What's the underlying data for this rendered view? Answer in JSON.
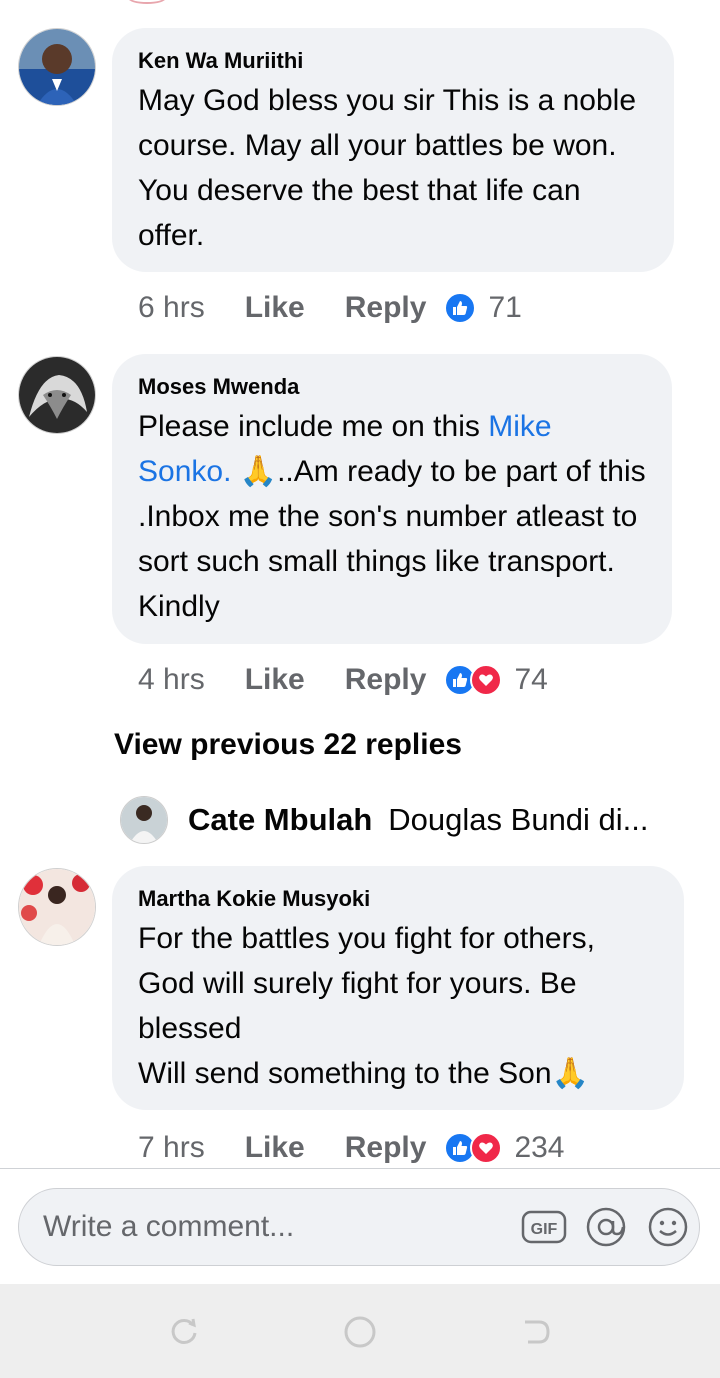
{
  "comments": [
    {
      "author": "Ken Wa Muriithi",
      "text": "May God bless you sir This is a noble course. May all your battles be won. You deserve the best that life can offer.",
      "time": "6 hrs",
      "like_label": "Like",
      "reply_label": "Reply",
      "reaction_count": "71"
    },
    {
      "author": "Moses Mwenda",
      "text_before": "Please include me on this ",
      "mention": "Mike Sonko.",
      "text_after": " 🙏..Am ready to be part of this .Inbox me the son's number atleast to sort such small things like transport. Kindly",
      "time": "4 hrs",
      "like_label": "Like",
      "reply_label": "Reply",
      "reaction_count": "74"
    },
    {
      "author": "Martha Kokie Musyoki",
      "text": "For the battles you fight for others, God will surely fight for yours. Be blessed",
      "text_line2": "Will send something to the Son🙏",
      "time": "7 hrs",
      "like_label": "Like",
      "reply_label": "Reply",
      "reaction_count": "234"
    }
  ],
  "view_previous": "View previous 22 replies",
  "reply_preview": {
    "name": "Cate Mbulah",
    "snippet": "Douglas Bundi di..."
  },
  "composer": {
    "placeholder": "Write a comment..."
  },
  "icons": {
    "gif": "gif-icon",
    "mention": "at-icon",
    "emoji": "emoji-icon",
    "like": "thumbs-up-icon",
    "love": "heart-icon"
  },
  "colors": {
    "link": "#1b74e4",
    "like": "#1877f2",
    "love": "#f02849",
    "bubble": "#f0f2f5"
  }
}
